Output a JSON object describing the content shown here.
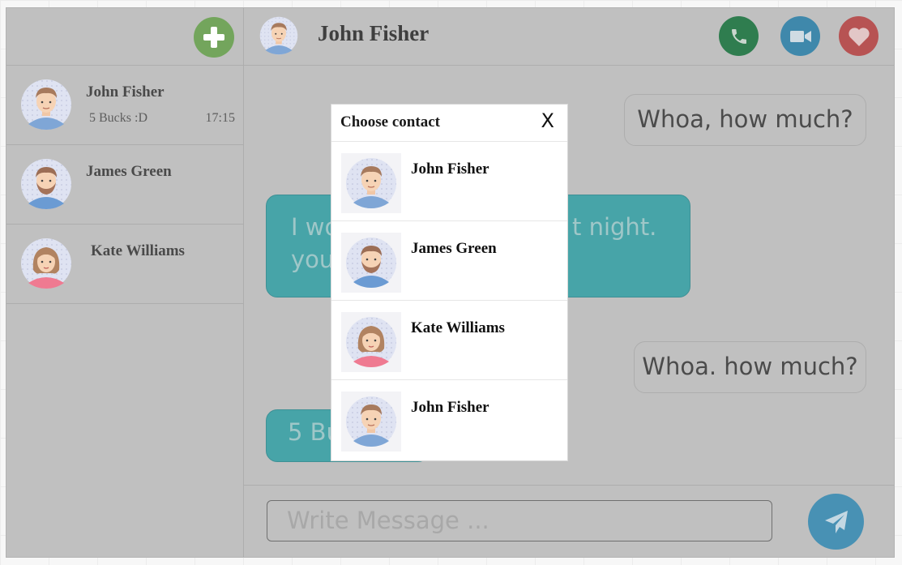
{
  "sidebar": {
    "add_button_icon": "plus-icon",
    "contacts": [
      {
        "name": "John Fisher",
        "preview": "5 Bucks :D",
        "time": "17:15",
        "avatar": "man-avatar"
      },
      {
        "name": "James Green",
        "preview": "",
        "time": "",
        "avatar": "bearded-man-avatar"
      },
      {
        "name": "Kate Williams",
        "preview": "",
        "time": "",
        "avatar": "woman-avatar"
      }
    ]
  },
  "chat": {
    "title": "John Fisher",
    "header_icons": [
      "phone-icon",
      "video-camera-icon",
      "heart-icon"
    ],
    "messages": [
      {
        "text": "Whoa, how much?",
        "direction": "out"
      },
      {
        "text": "I wo",
        "text_right": "t night.",
        "text_line2": "you",
        "direction": "in"
      },
      {
        "text": "Whoa. how much?",
        "direction": "out"
      },
      {
        "text": "5 Bu",
        "direction": "in"
      }
    ],
    "input_placeholder": "Write Message ...",
    "send_icon": "paper-plane-icon"
  },
  "modal": {
    "title": "Choose contact",
    "close_label": "X",
    "contacts": [
      {
        "name": "John Fisher",
        "avatar": "man-avatar"
      },
      {
        "name": "James Green",
        "avatar": "bearded-man-avatar"
      },
      {
        "name": "Kate Williams",
        "avatar": "woman-avatar"
      },
      {
        "name": "John Fisher",
        "avatar": "man-avatar"
      }
    ]
  },
  "colors": {
    "add": "#73a55c",
    "call": "#2f7d4f",
    "video": "#3f88ab",
    "heart": "#b75353",
    "send": "#4891b4",
    "incoming_bubble": "#47a4a8"
  }
}
